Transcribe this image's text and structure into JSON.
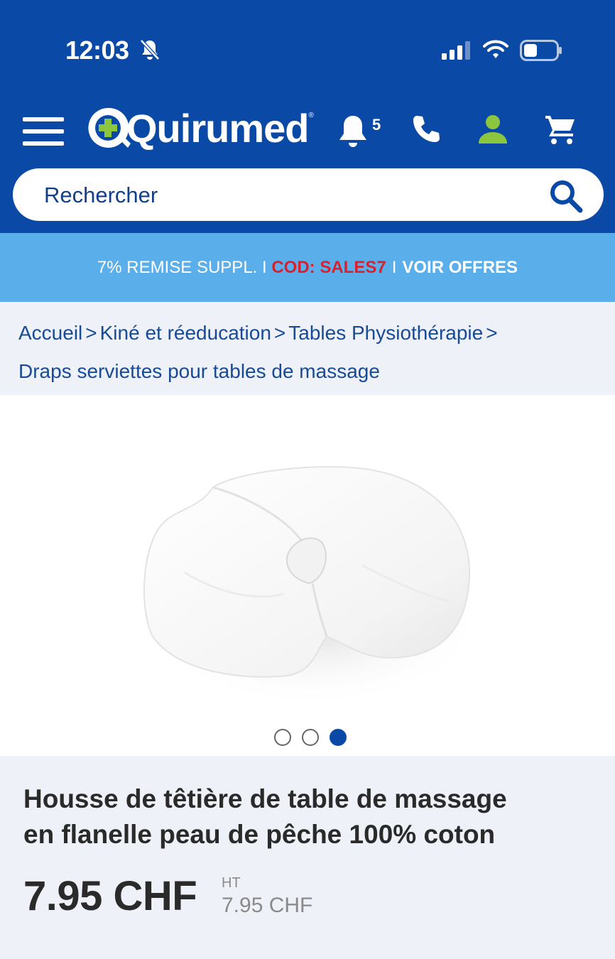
{
  "status_bar": {
    "time": "12:03"
  },
  "header": {
    "logo_text": "Quirumed",
    "logo_reg": "®",
    "notification_count": "5",
    "colors": {
      "primary": "#0a4aa6",
      "accent_green": "#8cc63f"
    }
  },
  "search": {
    "placeholder": "Rechercher"
  },
  "promo": {
    "text": "7% REMISE SUPPL. I",
    "code": "COD: SALES7",
    "separator": "I",
    "link": "VOIR OFFRES",
    "colors": {
      "background": "#5aaeea",
      "code": "#d7212f"
    }
  },
  "breadcrumb": {
    "items": [
      "Accueil",
      "Kiné et réeducation",
      "Tables Physiothérapie",
      "Draps serviettes pour tables de massage"
    ],
    "separator": ">"
  },
  "gallery": {
    "slides": 3,
    "active_index": 2
  },
  "product": {
    "title_line1": "Housse de têtière de table de massage",
    "title_line2": "en flanelle peau de pêche 100% coton",
    "price": "7.95 CHF",
    "ht_label": "HT",
    "ht_price": "7.95 CHF"
  }
}
